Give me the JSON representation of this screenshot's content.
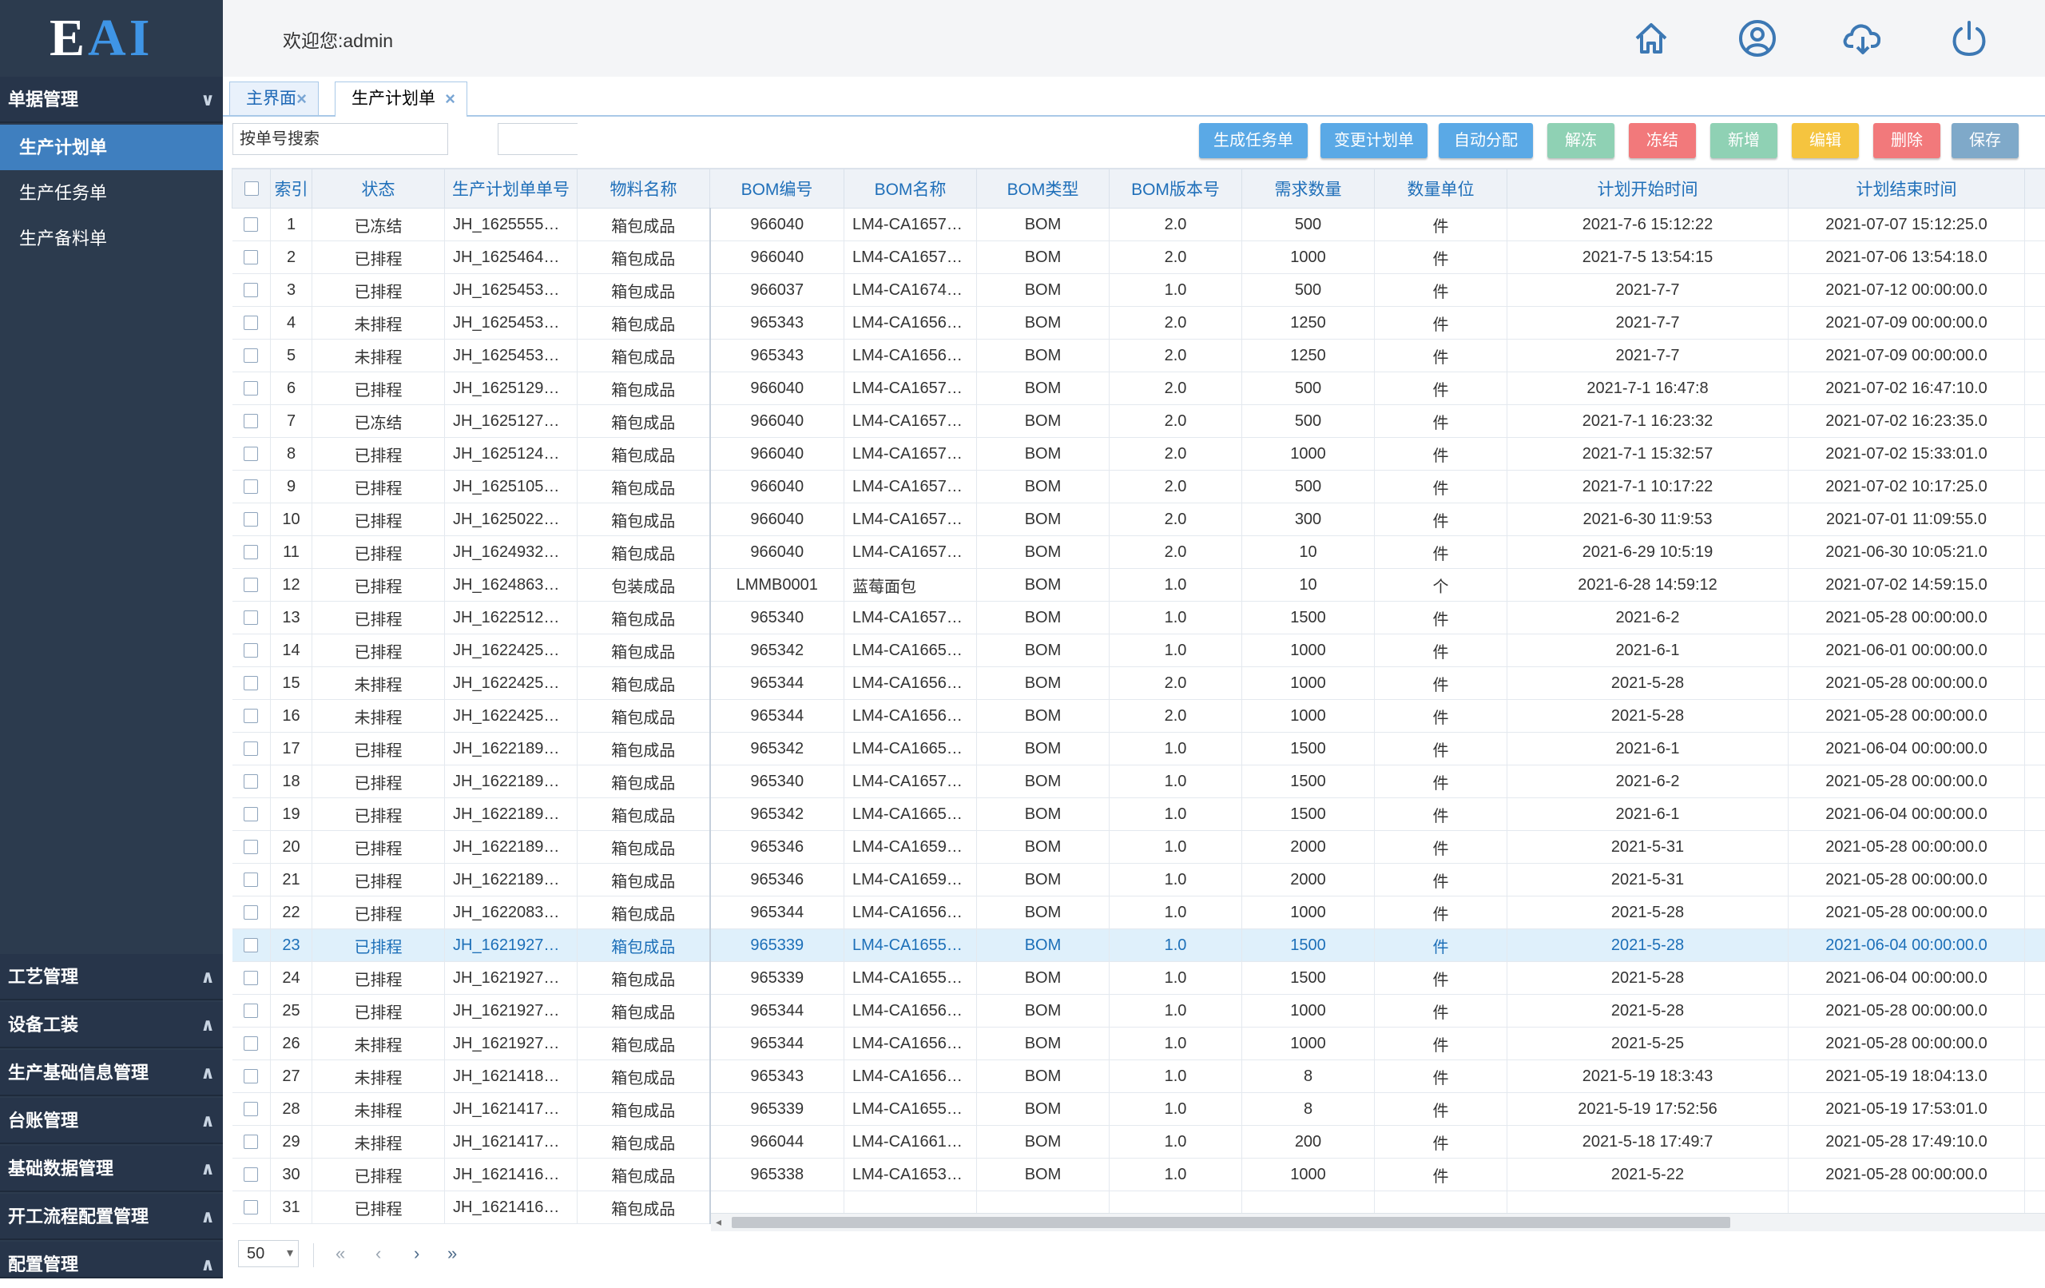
{
  "logo": {
    "e": "E",
    "ai": "AI"
  },
  "sidebar": {
    "top_section": {
      "label": "单据管理"
    },
    "items": [
      {
        "label": "生产计划单",
        "active": true
      },
      {
        "label": "生产任务单",
        "active": false
      },
      {
        "label": "生产备料单",
        "active": false
      }
    ],
    "bottom_sections": [
      {
        "label": "工艺管理"
      },
      {
        "label": "设备工装"
      },
      {
        "label": "生产基础信息管理"
      },
      {
        "label": "台账管理"
      },
      {
        "label": "基础数据管理"
      },
      {
        "label": "开工流程配置管理"
      },
      {
        "label": "配置管理"
      }
    ]
  },
  "header": {
    "welcome": "欢迎您:admin",
    "icons": [
      "home-icon",
      "user-icon",
      "cloud-download-icon",
      "power-icon"
    ]
  },
  "tabs": [
    {
      "label": "主界面",
      "active": false
    },
    {
      "label": "生产计划单",
      "active": true
    }
  ],
  "toolbar": {
    "search_placeholder": "按单号搜索",
    "buttons": [
      {
        "label": "生成任务单",
        "color": "#5aa9e6"
      },
      {
        "label": "变更计划单",
        "color": "#5aa9e6"
      },
      {
        "label": "自动分配",
        "color": "#5aa9e6"
      },
      {
        "label": "解冻",
        "color": "#8fd1b4"
      },
      {
        "label": "冻结",
        "color": "#f2797b"
      },
      {
        "label": "新增",
        "color": "#8fd1b4"
      },
      {
        "label": "编辑",
        "color": "#f5c43f"
      },
      {
        "label": "删除",
        "color": "#f2797b"
      },
      {
        "label": "保存",
        "color": "#7fa9c9"
      }
    ]
  },
  "table": {
    "columns": [
      "索引",
      "状态",
      "生产计划单单号",
      "物料名称",
      "BOM编号",
      "BOM名称",
      "BOM类型",
      "BOM版本号",
      "需求数量",
      "数量单位",
      "计划开始时间",
      "计划结束时间"
    ],
    "selected_index": 23,
    "rows": [
      [
        "1",
        "已冻结",
        "JH_1625555…",
        "箱包成品",
        "966040",
        "LM4-CA1657…",
        "BOM",
        "2.0",
        "500",
        "件",
        "2021-7-6 15:12:22",
        "2021-07-07 15:12:25.0"
      ],
      [
        "2",
        "已排程",
        "JH_1625464…",
        "箱包成品",
        "966040",
        "LM4-CA1657…",
        "BOM",
        "2.0",
        "1000",
        "件",
        "2021-7-5 13:54:15",
        "2021-07-06 13:54:18.0"
      ],
      [
        "3",
        "已排程",
        "JH_1625453…",
        "箱包成品",
        "966037",
        "LM4-CA1674…",
        "BOM",
        "1.0",
        "500",
        "件",
        "2021-7-7",
        "2021-07-12 00:00:00.0"
      ],
      [
        "4",
        "未排程",
        "JH_1625453…",
        "箱包成品",
        "965343",
        "LM4-CA1656…",
        "BOM",
        "2.0",
        "1250",
        "件",
        "2021-7-7",
        "2021-07-09 00:00:00.0"
      ],
      [
        "5",
        "未排程",
        "JH_1625453…",
        "箱包成品",
        "965343",
        "LM4-CA1656…",
        "BOM",
        "2.0",
        "1250",
        "件",
        "2021-7-7",
        "2021-07-09 00:00:00.0"
      ],
      [
        "6",
        "已排程",
        "JH_1625129…",
        "箱包成品",
        "966040",
        "LM4-CA1657…",
        "BOM",
        "2.0",
        "500",
        "件",
        "2021-7-1 16:47:8",
        "2021-07-02 16:47:10.0"
      ],
      [
        "7",
        "已冻结",
        "JH_1625127…",
        "箱包成品",
        "966040",
        "LM4-CA1657…",
        "BOM",
        "2.0",
        "500",
        "件",
        "2021-7-1 16:23:32",
        "2021-07-02 16:23:35.0"
      ],
      [
        "8",
        "已排程",
        "JH_1625124…",
        "箱包成品",
        "966040",
        "LM4-CA1657…",
        "BOM",
        "2.0",
        "1000",
        "件",
        "2021-7-1 15:32:57",
        "2021-07-02 15:33:01.0"
      ],
      [
        "9",
        "已排程",
        "JH_1625105…",
        "箱包成品",
        "966040",
        "LM4-CA1657…",
        "BOM",
        "2.0",
        "500",
        "件",
        "2021-7-1 10:17:22",
        "2021-07-02 10:17:25.0"
      ],
      [
        "10",
        "已排程",
        "JH_1625022…",
        "箱包成品",
        "966040",
        "LM4-CA1657…",
        "BOM",
        "2.0",
        "300",
        "件",
        "2021-6-30 11:9:53",
        "2021-07-01 11:09:55.0"
      ],
      [
        "11",
        "已排程",
        "JH_1624932…",
        "箱包成品",
        "966040",
        "LM4-CA1657…",
        "BOM",
        "2.0",
        "10",
        "件",
        "2021-6-29 10:5:19",
        "2021-06-30 10:05:21.0"
      ],
      [
        "12",
        "已排程",
        "JH_1624863…",
        "包装成品",
        "LMMB0001",
        "蓝莓面包",
        "BOM",
        "1.0",
        "10",
        "个",
        "2021-6-28 14:59:12",
        "2021-07-02 14:59:15.0"
      ],
      [
        "13",
        "已排程",
        "JH_1622512…",
        "箱包成品",
        "965340",
        "LM4-CA1657…",
        "BOM",
        "1.0",
        "1500",
        "件",
        "2021-6-2",
        "2021-05-28 00:00:00.0"
      ],
      [
        "14",
        "已排程",
        "JH_1622425…",
        "箱包成品",
        "965342",
        "LM4-CA1665…",
        "BOM",
        "1.0",
        "1000",
        "件",
        "2021-6-1",
        "2021-06-01 00:00:00.0"
      ],
      [
        "15",
        "未排程",
        "JH_1622425…",
        "箱包成品",
        "965344",
        "LM4-CA1656…",
        "BOM",
        "2.0",
        "1000",
        "件",
        "2021-5-28",
        "2021-05-28 00:00:00.0"
      ],
      [
        "16",
        "未排程",
        "JH_1622425…",
        "箱包成品",
        "965344",
        "LM4-CA1656…",
        "BOM",
        "2.0",
        "1000",
        "件",
        "2021-5-28",
        "2021-05-28 00:00:00.0"
      ],
      [
        "17",
        "已排程",
        "JH_1622189…",
        "箱包成品",
        "965342",
        "LM4-CA1665…",
        "BOM",
        "1.0",
        "1500",
        "件",
        "2021-6-1",
        "2021-06-04 00:00:00.0"
      ],
      [
        "18",
        "已排程",
        "JH_1622189…",
        "箱包成品",
        "965340",
        "LM4-CA1657…",
        "BOM",
        "1.0",
        "1500",
        "件",
        "2021-6-2",
        "2021-05-28 00:00:00.0"
      ],
      [
        "19",
        "已排程",
        "JH_1622189…",
        "箱包成品",
        "965342",
        "LM4-CA1665…",
        "BOM",
        "1.0",
        "1500",
        "件",
        "2021-6-1",
        "2021-06-04 00:00:00.0"
      ],
      [
        "20",
        "已排程",
        "JH_1622189…",
        "箱包成品",
        "965346",
        "LM4-CA1659…",
        "BOM",
        "1.0",
        "2000",
        "件",
        "2021-5-31",
        "2021-05-28 00:00:00.0"
      ],
      [
        "21",
        "已排程",
        "JH_1622189…",
        "箱包成品",
        "965346",
        "LM4-CA1659…",
        "BOM",
        "1.0",
        "2000",
        "件",
        "2021-5-31",
        "2021-05-28 00:00:00.0"
      ],
      [
        "22",
        "已排程",
        "JH_1622083…",
        "箱包成品",
        "965344",
        "LM4-CA1656…",
        "BOM",
        "1.0",
        "1000",
        "件",
        "2021-5-28",
        "2021-05-28 00:00:00.0"
      ],
      [
        "23",
        "已排程",
        "JH_1621927…",
        "箱包成品",
        "965339",
        "LM4-CA1655…",
        "BOM",
        "1.0",
        "1500",
        "件",
        "2021-5-28",
        "2021-06-04 00:00:00.0"
      ],
      [
        "24",
        "已排程",
        "JH_1621927…",
        "箱包成品",
        "965339",
        "LM4-CA1655…",
        "BOM",
        "1.0",
        "1500",
        "件",
        "2021-5-28",
        "2021-06-04 00:00:00.0"
      ],
      [
        "25",
        "已排程",
        "JH_1621927…",
        "箱包成品",
        "965344",
        "LM4-CA1656…",
        "BOM",
        "1.0",
        "1000",
        "件",
        "2021-5-28",
        "2021-05-28 00:00:00.0"
      ],
      [
        "26",
        "未排程",
        "JH_1621927…",
        "箱包成品",
        "965344",
        "LM4-CA1656…",
        "BOM",
        "1.0",
        "1000",
        "件",
        "2021-5-25",
        "2021-05-28 00:00:00.0"
      ],
      [
        "27",
        "未排程",
        "JH_1621418…",
        "箱包成品",
        "965343",
        "LM4-CA1656…",
        "BOM",
        "1.0",
        "8",
        "件",
        "2021-5-19 18:3:43",
        "2021-05-19 18:04:13.0"
      ],
      [
        "28",
        "未排程",
        "JH_1621417…",
        "箱包成品",
        "965339",
        "LM4-CA1655…",
        "BOM",
        "1.0",
        "8",
        "件",
        "2021-5-19 17:52:56",
        "2021-05-19 17:53:01.0"
      ],
      [
        "29",
        "未排程",
        "JH_1621417…",
        "箱包成品",
        "966044",
        "LM4-CA1661…",
        "BOM",
        "1.0",
        "200",
        "件",
        "2021-5-18 17:49:7",
        "2021-05-28 17:49:10.0"
      ],
      [
        "30",
        "已排程",
        "JH_1621416…",
        "箱包成品",
        "965338",
        "LM4-CA1653…",
        "BOM",
        "1.0",
        "1000",
        "件",
        "2021-5-22",
        "2021-05-28 00:00:00.0"
      ],
      [
        "31",
        "已排程",
        "JH_1621416…",
        "箱包成品",
        "",
        "",
        "",
        "",
        "",
        "",
        "",
        ""
      ]
    ]
  },
  "pager": {
    "page_size": "50"
  }
}
